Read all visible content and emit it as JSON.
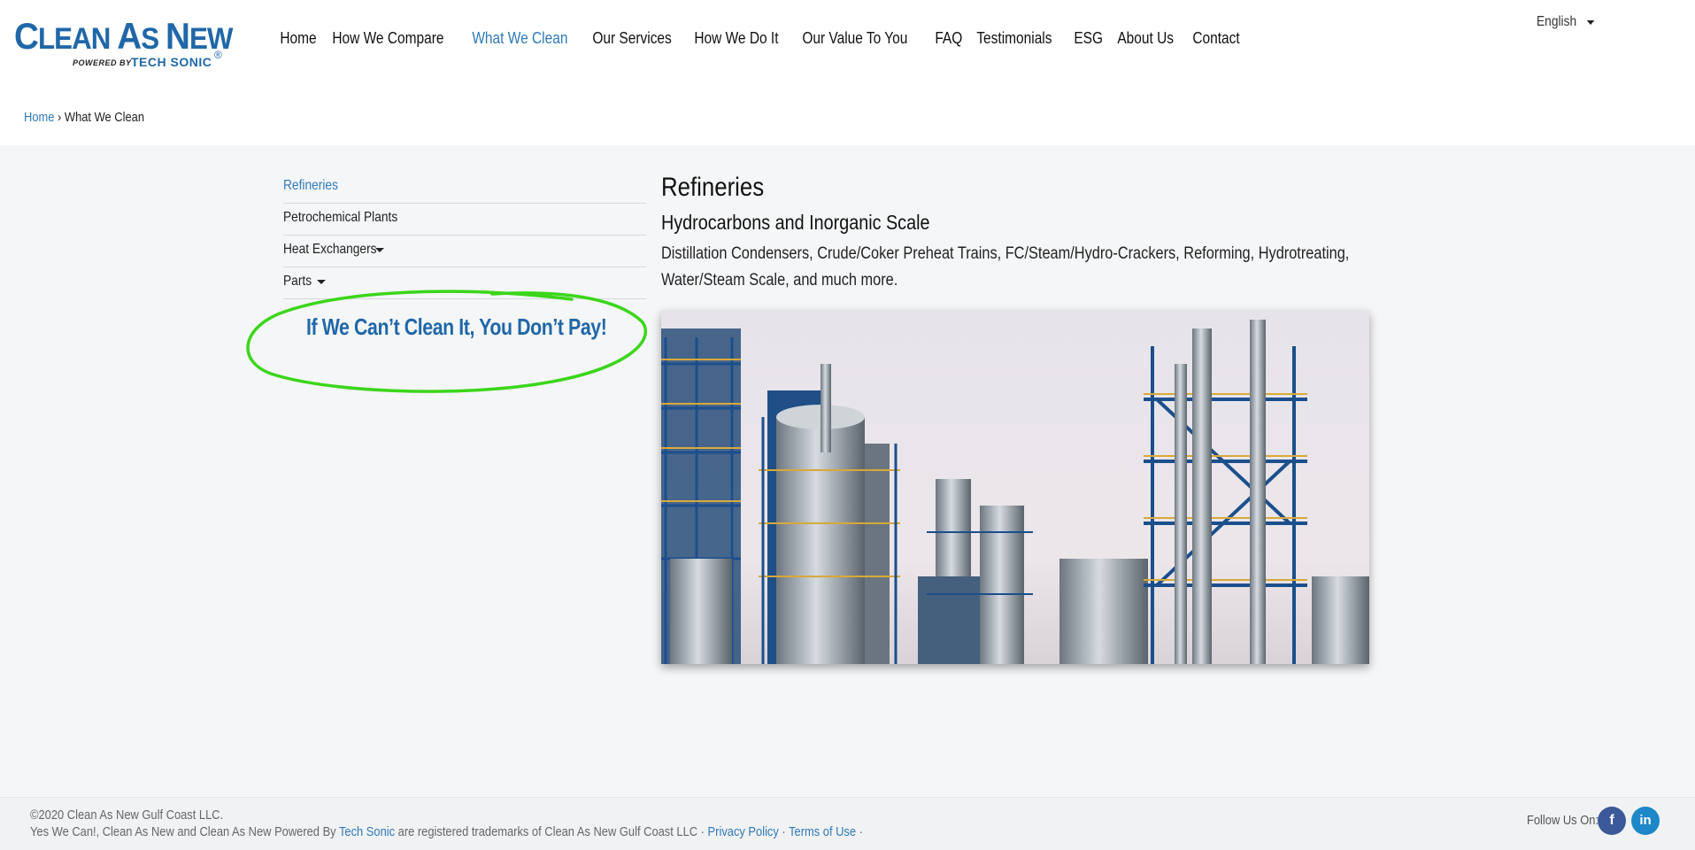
{
  "logo": {
    "name_big_1": "C",
    "name_small_1": "LEAN ",
    "name_big_2": "A",
    "name_small_2": "S ",
    "name_big_3": "N",
    "name_small_3": "EW",
    "powered_by": "POWERED BY",
    "tech_sonic": "TECH SONIC",
    "registered": "®"
  },
  "nav": {
    "items": [
      {
        "label": "Home"
      },
      {
        "label": "How We Compare"
      },
      {
        "label": "What We Clean"
      },
      {
        "label": "Our Services"
      },
      {
        "label": "How We Do It"
      },
      {
        "label": "Our Value To You"
      },
      {
        "label": "FAQ"
      },
      {
        "label": "Testimonials"
      },
      {
        "label": "ESG"
      },
      {
        "label": "About Us"
      },
      {
        "label": "Contact"
      }
    ],
    "active_index": 2
  },
  "language": {
    "selected": "English"
  },
  "breadcrumb": {
    "home": "Home",
    "separator": "›",
    "current": "What We Clean"
  },
  "sidebar": {
    "items": [
      {
        "label": "Refineries"
      },
      {
        "label": "Petrochemical Plants"
      },
      {
        "label": "Heat Exchangers"
      },
      {
        "label": "Parts"
      }
    ]
  },
  "promo": {
    "text": "If We Can’t Clean It, You Don’t Pay!"
  },
  "content": {
    "title": "Refineries",
    "subtitle": "Hydrocarbons and Inorganic Scale",
    "description": "Distillation Condensers, Crude/Coker Preheat Trains, FC/Steam/Hydro-Crackers, Reforming, Hydrotreating, Water/Steam Scale, and much more."
  },
  "footer": {
    "copyright": "©2020 Clean As New Gulf Coast LLC.",
    "trademark_prefix": "Yes We Can!, Clean As New and Clean As New Powered By ",
    "trademark_link": "Tech Sonic",
    "trademark_suffix": " are registered trademarks of Clean As New Gulf Coast LLC · ",
    "privacy": "Privacy Policy",
    "sep": " · ",
    "terms": "Terms of Use",
    "end": " ·",
    "follow": "Follow Us On:",
    "facebook_glyph": "f",
    "linkedin_glyph": "in"
  },
  "colors": {
    "brand_blue": "#1f67a8",
    "link_blue": "#2f79b9",
    "annotation_green": "#3bd61a",
    "facebook": "#3b5998",
    "linkedin": "#1d87c8"
  }
}
